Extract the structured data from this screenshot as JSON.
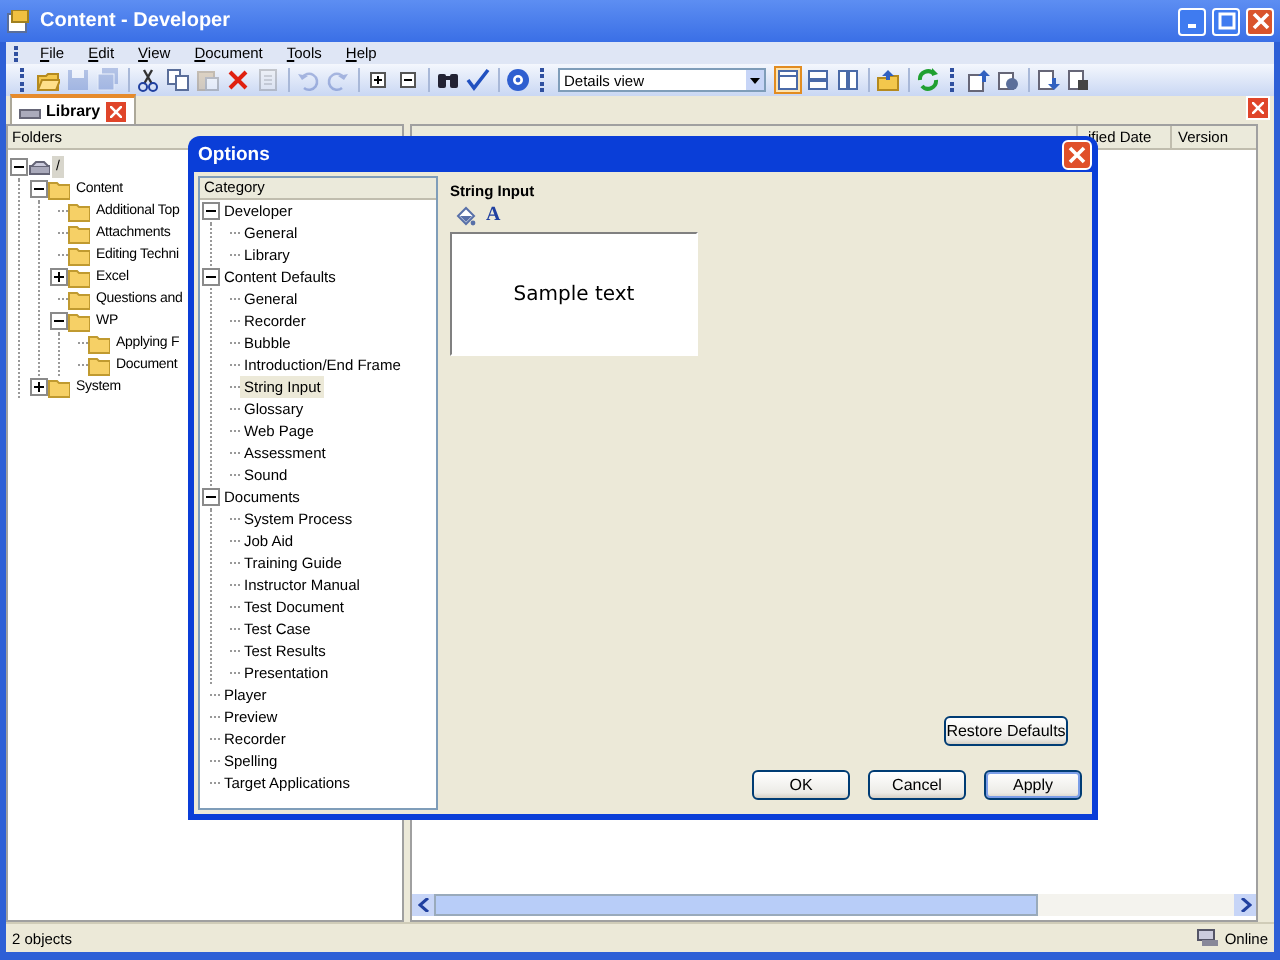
{
  "window": {
    "title": "Content - Developer"
  },
  "menu": [
    "File",
    "Edit",
    "View",
    "Document",
    "Tools",
    "Help"
  ],
  "toolbar": {
    "buttons": [
      {
        "kind": "open",
        "disabled": false
      },
      {
        "kind": "save",
        "disabled": true
      },
      {
        "kind": "save_all",
        "disabled": true
      },
      {
        "kind": "sep"
      },
      {
        "kind": "cut",
        "disabled": false
      },
      {
        "kind": "copy",
        "disabled": false
      },
      {
        "kind": "paste",
        "disabled": true
      },
      {
        "kind": "delete",
        "disabled": false
      },
      {
        "kind": "properties",
        "disabled": true
      },
      {
        "kind": "sep"
      },
      {
        "kind": "undo",
        "disabled": true
      },
      {
        "kind": "redo",
        "disabled": true
      },
      {
        "kind": "sep"
      },
      {
        "kind": "expand",
        "disabled": false
      },
      {
        "kind": "collapse",
        "disabled": false
      },
      {
        "kind": "sep"
      },
      {
        "kind": "find",
        "disabled": false
      },
      {
        "kind": "spell",
        "disabled": false
      },
      {
        "kind": "sep"
      },
      {
        "kind": "help",
        "disabled": false
      }
    ],
    "view_select": {
      "value": "Details view"
    },
    "view_buttons": [
      {
        "kind": "details",
        "selected": true
      },
      {
        "kind": "horizontal",
        "selected": false
      },
      {
        "kind": "vertical",
        "selected": false
      },
      {
        "kind": "sep"
      },
      {
        "kind": "folder_up",
        "selected": false
      },
      {
        "kind": "sep"
      },
      {
        "kind": "refresh",
        "selected": false
      },
      {
        "kind": "grip"
      },
      {
        "kind": "upload",
        "selected": false
      },
      {
        "kind": "publish",
        "selected": false
      },
      {
        "kind": "sep"
      },
      {
        "kind": "download",
        "selected": false
      },
      {
        "kind": "lock",
        "selected": false
      }
    ]
  },
  "tabs": [
    {
      "label": "Library",
      "selected": true
    }
  ],
  "folders": {
    "header": "Folders",
    "tree": [
      {
        "label": "/",
        "selected": true,
        "expanded": true,
        "children": [
          {
            "label": "Content",
            "selected": false,
            "expanded": true,
            "children": [
              {
                "label": "Additional Top",
                "selected": false
              },
              {
                "label": "Attachments",
                "selected": false
              },
              {
                "label": "Editing Techni",
                "selected": false
              },
              {
                "label": "Excel",
                "selected": false,
                "expanded": false
              },
              {
                "label": "Questions and",
                "selected": false
              },
              {
                "label": "WP",
                "selected": false,
                "expanded": true,
                "children": [
                  {
                    "label": "Applying F",
                    "selected": false
                  },
                  {
                    "label": "Document",
                    "selected": false
                  }
                ]
              }
            ]
          },
          {
            "label": "System",
            "selected": false,
            "expanded": false
          }
        ]
      }
    ]
  },
  "list": {
    "columns": [
      "ified Date",
      "Version"
    ]
  },
  "status_bar": {
    "text": "2 objects",
    "connection": "Online"
  },
  "dialog": {
    "title": "Options",
    "category_header": "Category",
    "tree": [
      {
        "label": "Developer",
        "selected": false,
        "expanded": true,
        "children": [
          {
            "label": "General",
            "selected": false
          },
          {
            "label": "Library",
            "selected": false
          }
        ]
      },
      {
        "label": "Content Defaults",
        "selected": false,
        "expanded": true,
        "children": [
          {
            "label": "General",
            "selected": false
          },
          {
            "label": "Recorder",
            "selected": false
          },
          {
            "label": "Bubble",
            "selected": false
          },
          {
            "label": "Introduction/End Frame",
            "selected": false
          },
          {
            "label": "String Input",
            "selected": true
          },
          {
            "label": "Glossary",
            "selected": false
          },
          {
            "label": "Web Page",
            "selected": false
          },
          {
            "label": "Assessment",
            "selected": false
          },
          {
            "label": "Sound",
            "selected": false
          }
        ]
      },
      {
        "label": "Documents",
        "selected": false,
        "expanded": true,
        "children": [
          {
            "label": "System Process",
            "selected": false
          },
          {
            "label": "Job Aid",
            "selected": false
          },
          {
            "label": "Training Guide",
            "selected": false
          },
          {
            "label": "Instructor Manual",
            "selected": false
          },
          {
            "label": "Test Document",
            "selected": false
          },
          {
            "label": "Test Case",
            "selected": false
          },
          {
            "label": "Test Results",
            "selected": false
          },
          {
            "label": "Presentation",
            "selected": false
          }
        ]
      },
      {
        "label": "Player",
        "selected": false
      },
      {
        "label": "Preview",
        "selected": false
      },
      {
        "label": "Recorder",
        "selected": false
      },
      {
        "label": "Spelling",
        "selected": false
      },
      {
        "label": "Target Applications",
        "selected": false
      }
    ],
    "section_title": "String Input",
    "font_button": "A",
    "preview_text": "Sample text",
    "restore_button": "Restore Defaults",
    "buttons": [
      "OK",
      "Cancel",
      "Apply"
    ]
  }
}
